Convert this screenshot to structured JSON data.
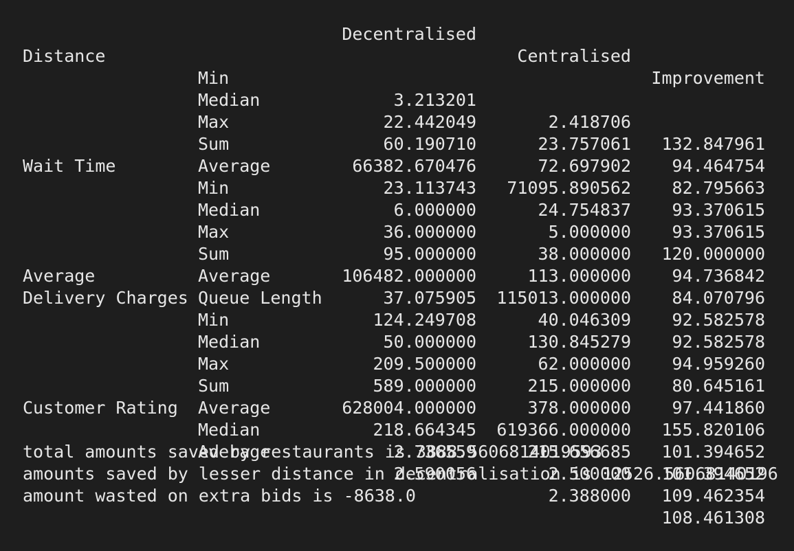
{
  "header": {
    "decentralised": "Decentralised",
    "centralised": "Centralised",
    "improvement": "Improvement"
  },
  "rows": [
    {
      "group": "Distance",
      "stat": "Min",
      "dec": "3.213201",
      "cen": "2.418706",
      "imp": "132.847961"
    },
    {
      "group": "",
      "stat": "Median",
      "dec": "22.442049",
      "cen": "23.757061",
      "imp": "94.464754"
    },
    {
      "group": "",
      "stat": "Max",
      "dec": "60.190710",
      "cen": "72.697902",
      "imp": "82.795663"
    },
    {
      "group": "",
      "stat": "Sum",
      "dec": "66382.670476",
      "cen": "71095.890562",
      "imp": "93.370615"
    },
    {
      "group": "",
      "stat": "Average",
      "dec": "23.113743",
      "cen": "24.754837",
      "imp": "93.370615"
    },
    {
      "group": "Wait Time",
      "stat": "Min",
      "dec": "6.000000",
      "cen": "5.000000",
      "imp": "120.000000"
    },
    {
      "group": "",
      "stat": "Median",
      "dec": "36.000000",
      "cen": "38.000000",
      "imp": "94.736842"
    },
    {
      "group": "",
      "stat": "Max",
      "dec": "95.000000",
      "cen": "113.000000",
      "imp": "84.070796"
    },
    {
      "group": "",
      "stat": "Sum",
      "dec": "106482.000000",
      "cen": "115013.000000",
      "imp": "92.582578"
    },
    {
      "group": "",
      "stat": "Average",
      "dec": "37.075905",
      "cen": "40.046309",
      "imp": "92.582578"
    },
    {
      "group": "Average",
      "stat": "Queue Length",
      "dec": "124.249708",
      "cen": "130.845279",
      "imp": "94.959260"
    },
    {
      "group": "Delivery Charges",
      "stat": "Min",
      "dec": "50.000000",
      "cen": "62.000000",
      "imp": "80.645161"
    },
    {
      "group": "",
      "stat": "Median",
      "dec": "209.500000",
      "cen": "215.000000",
      "imp": "97.441860"
    },
    {
      "group": "",
      "stat": "Max",
      "dec": "589.000000",
      "cen": "378.000000",
      "imp": "155.820106"
    },
    {
      "group": "",
      "stat": "Sum",
      "dec": "628004.000000",
      "cen": "619366.000000",
      "imp": "101.394652"
    },
    {
      "group": "",
      "stat": "Average",
      "dec": "218.664345",
      "cen": "215.656685",
      "imp": "101.394652"
    },
    {
      "group": "Customer Rating",
      "stat": "Median",
      "dec": "2.736559",
      "cen": "2.500000",
      "imp": "109.462354"
    },
    {
      "group": "",
      "stat": "Average",
      "dec": "2.590056",
      "cen": "2.388000",
      "imp": "108.461308"
    }
  ],
  "messages": [
    "total amounts saved by restaurants is 3888.5606814019593",
    "amounts saved by lesser distance in decentralisation is 12526.56068140196",
    "amount wasted on extra bids is -8638.0"
  ]
}
